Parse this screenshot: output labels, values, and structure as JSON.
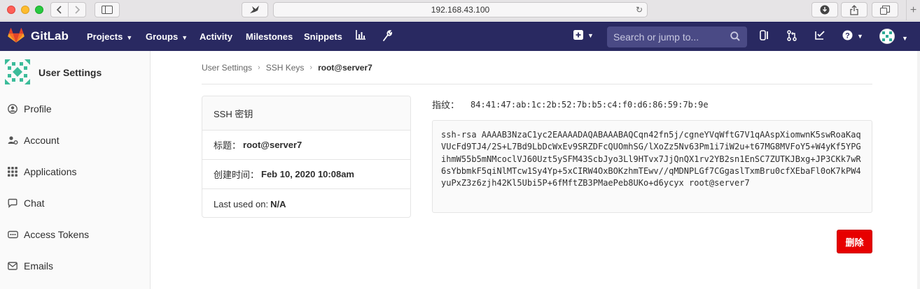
{
  "browser": {
    "url": "192.168.43.100"
  },
  "header": {
    "brand": "GitLab",
    "nav": [
      {
        "label": "Projects",
        "has_caret": true
      },
      {
        "label": "Groups",
        "has_caret": true
      },
      {
        "label": "Activity",
        "has_caret": false
      },
      {
        "label": "Milestones",
        "has_caret": false
      },
      {
        "label": "Snippets",
        "has_caret": false
      }
    ],
    "search_placeholder": "Search or jump to...",
    "accent_color": "#292961",
    "icons": [
      "chart-icon",
      "wrench-icon",
      "plus-square-icon",
      "sidebar-panel-icon",
      "merge-request-icon",
      "todo-check-icon",
      "help-icon",
      "user-avatar"
    ]
  },
  "sidebar": {
    "title": "User Settings",
    "items": [
      {
        "label": "Profile",
        "icon": "profile-icon"
      },
      {
        "label": "Account",
        "icon": "account-gear-icon"
      },
      {
        "label": "Applications",
        "icon": "applications-grid-icon"
      },
      {
        "label": "Chat",
        "icon": "chat-icon"
      },
      {
        "label": "Access Tokens",
        "icon": "token-icon"
      },
      {
        "label": "Emails",
        "icon": "email-icon"
      }
    ]
  },
  "breadcrumb": {
    "items": [
      "User Settings",
      "SSH Keys",
      "root@server7"
    ]
  },
  "key_card": {
    "header": "SSH 密钥",
    "title_label": "标题：",
    "title_value": "root@server7",
    "created_label": "创建时间：",
    "created_value": "Feb 10, 2020 10:08am",
    "last_used_label": "Last used on:",
    "last_used_value": "N/A"
  },
  "fingerprint": {
    "label": "指纹：",
    "value": "84:41:47:ab:1c:2b:52:7b:b5:c4:f0:d6:86:59:7b:9e"
  },
  "ssh_key_text": "ssh-rsa AAAAB3NzaC1yc2EAAAADAQABAAABAQCqn42fn5j/cgneYVqWftG7V1qAAspXiomwnK5swRoaKaqVUcFd9TJ4/2S+L7Bd9LbDcWxEv9SRZDFcQUOmhSG/lXoZz5Nv63Pm1i7iW2u+t67MG8MVFoY5+W4yKf5YPGihmW55b5mNMcoclVJ60Uzt5ySFM43ScbJyo3Ll9HTvx7JjQnQX1rv2YB2sn1EnSC7ZUTKJBxg+JP3CKk7wR6sYbbmkF5qiNlMTcw1Sy4Yp+5xCIRW4OxBOKzhmTEwv//qMDNPLGf7CGgaslTxmBru0cfXEbaFl0oK7kPW4yuPxZ3z6zjh42Kl5Ubi5P+6fMftZB3PMaePeb8UKo+d6ycyx root@server7",
  "delete_button": {
    "label": "删除",
    "color": "#e70000"
  }
}
